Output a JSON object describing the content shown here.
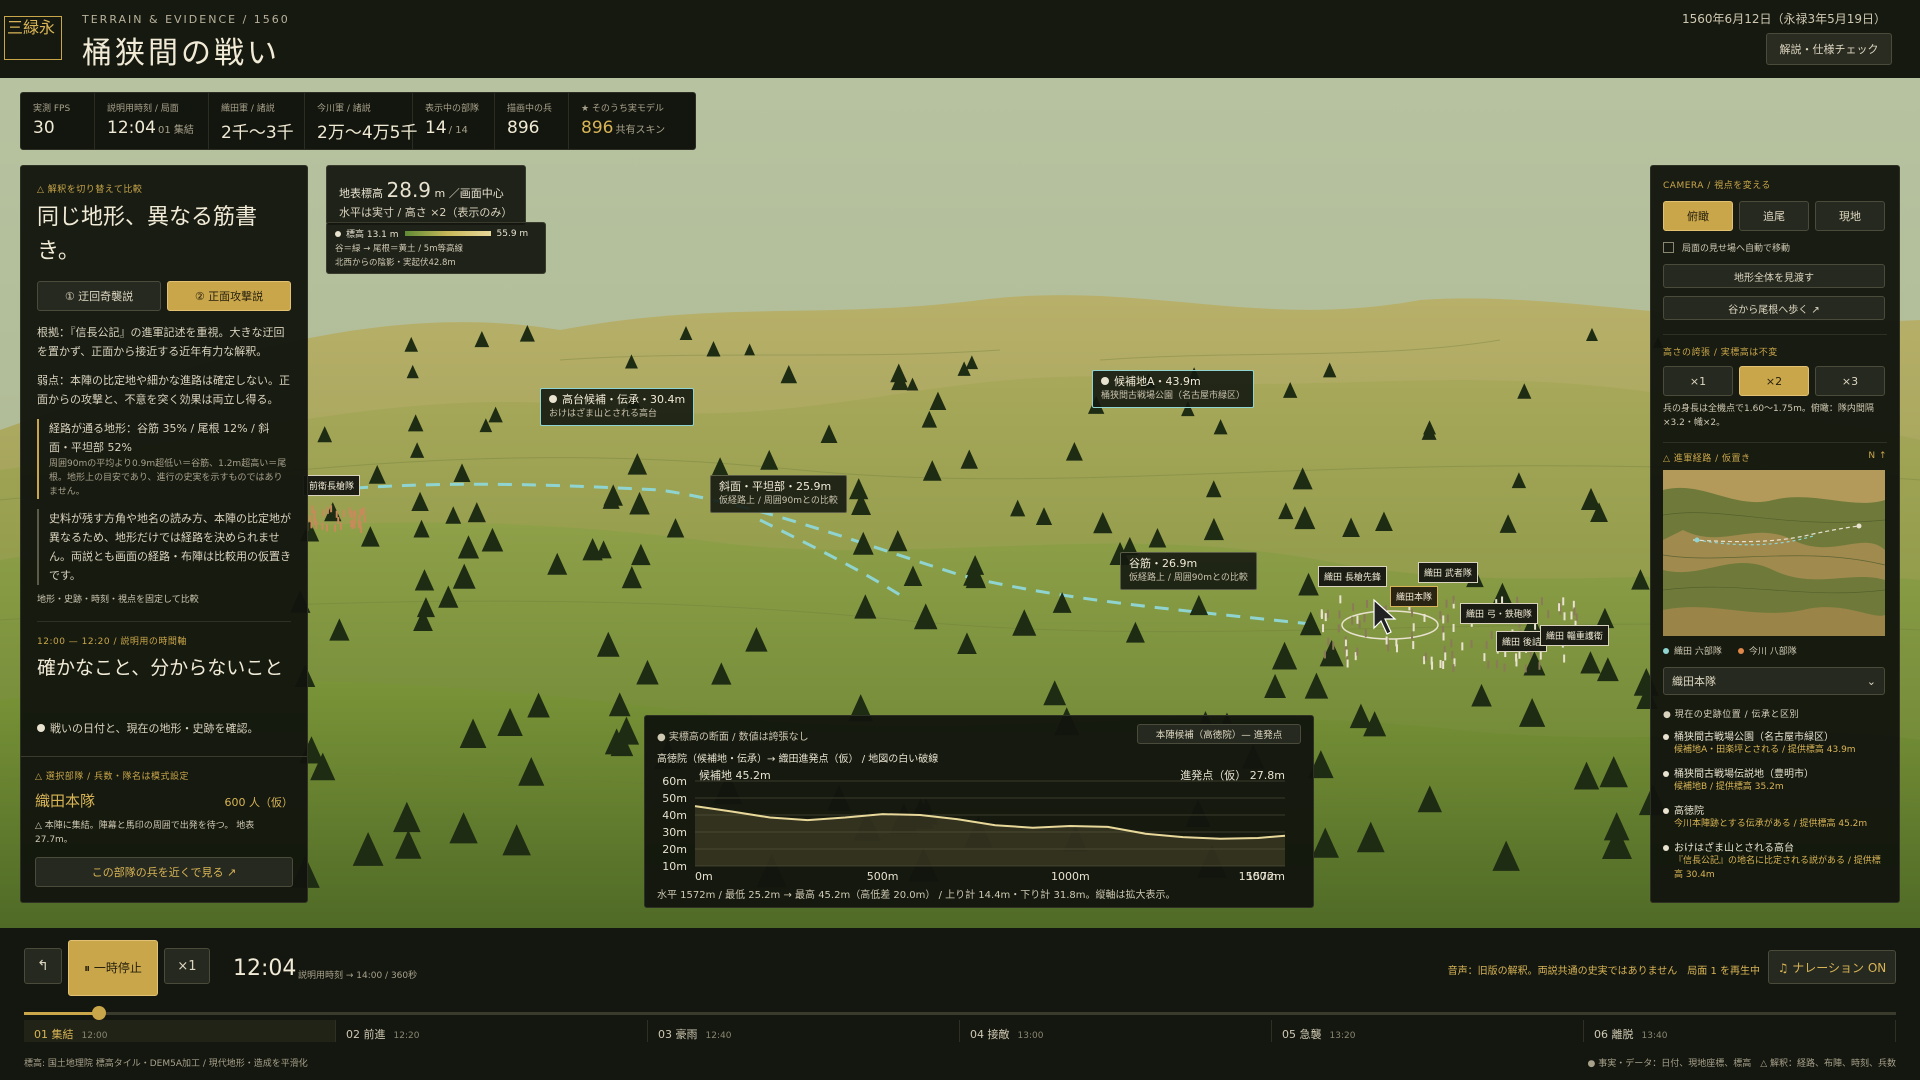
{
  "header": {
    "logo": "三緑永",
    "supertitle": "TERRAIN & EVIDENCE / 1560",
    "title": "桶狭間の戦い",
    "date": "1560年6月12日（永禄3年5月19日）",
    "spec_button": "解説・仕様チェック"
  },
  "stats": [
    {
      "label": "実測 FPS",
      "value": "30",
      "sub": ""
    },
    {
      "label": "説明用時刻 / 局面",
      "value": "12:04",
      "sub": "01 集結"
    },
    {
      "label": "織田軍 / 諸説",
      "value": "2千〜3千",
      "sub": ""
    },
    {
      "label": "今川軍 / 諸説",
      "value": "2万〜4万5千",
      "sub": ""
    },
    {
      "label": "表示中の部隊",
      "value": "14",
      "sub": "/ 14"
    },
    {
      "label": "描画中の兵",
      "value": "896",
      "sub": ""
    },
    {
      "label": "★ そのうち実モデル",
      "value": "896",
      "sub": "共有スキン"
    }
  ],
  "left": {
    "sec1": "△ 解釈を切り替えて比較",
    "heading1": "同じ地形、異なる筋書き。",
    "tab1": "① 迂回奇襲説",
    "tab2": "② 正面攻撃説",
    "p1": "根拠：『信長公記』の進軍記述を重視。大きな迂回を置かず、正面から接近する近年有力な解釈。",
    "p2": "弱点：本陣の比定地や細かな進路は確定しない。正面からの攻撃と、不意を突く効果は両立し得る。",
    "q_main": "経路が通る地形：谷筋 35% / 尾根 12% / 斜面・平坦部 52%",
    "q_small": "周囲90mの平均より0.9m超低い＝谷筋、1.2m超高い＝尾根。地形上の目安であり、進行の史実を示すものではありません。",
    "p3": "史料が残す方角や地名の読み方、本陣の比定地が異なるため、地形だけでは経路を決められません。両説とも画面の経路・布陣は比較用の仮置きです。",
    "fixed_note": "地形・史跡・時刻・視点を固定して比較",
    "sec2": "12:00 — 12:20 / 説明用の時間軸",
    "heading2": "確かなこと、分からないこと",
    "bullet": "戦いの日付と、現在の地形・史跡を確認。",
    "sec3": "△ 選択部隊 / 兵数・隊名は模式設定",
    "unit_name": "織田本隊",
    "unit_count": "600 人（仮）",
    "unit_desc": "△ 本陣に集結。陣幕と馬印の周囲で出発を待つ。 地表 27.7m。",
    "unit_button": "この部隊の兵を近くで見る ↗"
  },
  "elev": {
    "prefix": "地表標高",
    "value": "28.9",
    "unit": "m",
    "suffix": "／画面中心",
    "line2": "水平は実寸 / 高さ ×2（表示のみ）",
    "lg_min": "標高 13.1 m",
    "lg_max": "55.9 m",
    "lg_note1": "谷＝緑 → 尾根＝黄土 / 5m等高線",
    "lg_note2": "北西からの陰影・実起伏42.8m"
  },
  "labels": [
    {
      "title": "高台候補・伝承・30.4m",
      "sub": "おけはざま山とされる高台",
      "dot": true
    },
    {
      "title": "候補地A・43.9m",
      "sub": "桶狭間古戦場公園（名古屋市緑区）",
      "dot": true
    },
    {
      "title": "斜面・平坦部・25.9m",
      "sub": "仮経路上 / 周囲90mとの比較",
      "dot": false
    },
    {
      "title": "谷筋・26.9m",
      "sub": "仮経路上 / 周囲90mとの比較",
      "dot": false
    }
  ],
  "units": [
    "前衛長槍隊",
    "織田 長槍先鋒",
    "織田 武者隊",
    "織田本隊",
    "織田 弓・鉄砲隊",
    "織田 後詰",
    "織田 輜重護衛"
  ],
  "right": {
    "sec_camera": "CAMERA / 視点を変える",
    "cam": [
      "俯瞰",
      "追尾",
      "現地"
    ],
    "auto_move": "局面の見せ場へ自動で移動",
    "btn_overview": "地形全体を見渡す",
    "btn_walk": "谷から尾根へ歩く ↗",
    "sec_height": "高さの誇張 / 実標高は不変",
    "height": [
      "×1",
      "×2",
      "×3"
    ],
    "height_note": "兵の身長は全機点で1.60〜1.75m。俯瞰：隊内間隔×3.2・幟×2。",
    "sec_map": "△ 進軍経路 / 仮置き",
    "map_north": "N ↑",
    "legend_oda": "織田 六部隊",
    "legend_imagawa": "今川 八部隊",
    "select": "織田本隊",
    "sec_sites": "● 現在の史跡位置 / 伝承と区別",
    "sites": [
      {
        "name": "桶狭間古戦場公園（名古屋市緑区）",
        "sub": "候補地A・田楽坪とされる / 提供標高 43.9m"
      },
      {
        "name": "桶狭間古戦場伝説地（豊明市）",
        "sub": "候補地B / 提供標高 35.2m"
      },
      {
        "name": "高徳院",
        "sub": "今川本陣跡とする伝承がある / 提供標高 45.2m"
      },
      {
        "name": "おけはざま山とされる高台",
        "sub": "『信長公記』の地名に比定される説がある / 提供標高 30.4m"
      }
    ]
  },
  "chart_data": {
    "type": "area",
    "title": "● 実標高の断面 / 数値は誇張なし",
    "subtitle": "高徳院（候補地・伝承）→ 織田進発点（仮） / 地図の白い破線",
    "dropdown": "本陣候補（高徳院）— 進発点",
    "start_label": "候補地 45.2m",
    "end_label": "進発点（仮） 27.8m",
    "x": [
      0,
      100,
      200,
      300,
      400,
      500,
      600,
      700,
      800,
      900,
      1000,
      1100,
      1200,
      1300,
      1400,
      1500,
      1572
    ],
    "y": [
      45.2,
      42.0,
      38.5,
      37.0,
      38.5,
      40.5,
      40.0,
      37.5,
      34.0,
      32.5,
      33.5,
      33.0,
      29.0,
      27.0,
      26.0,
      26.5,
      27.8
    ],
    "yticks": [
      "60m",
      "50m",
      "40m",
      "30m",
      "20m",
      "10m"
    ],
    "yvals": [
      60,
      50,
      40,
      30,
      20,
      10
    ],
    "ylim": [
      10,
      60
    ],
    "xticks": [
      "0m",
      "500m",
      "1000m",
      "1500m",
      "1572m"
    ],
    "xvals": [
      0,
      500,
      1000,
      1500,
      1572
    ],
    "xlim": [
      0,
      1572
    ],
    "footer": "水平 1572m / 最低 25.2m → 最高 45.2m（高低差 20.0m） / 上り計 14.4m・下り計 31.8m。縦軸は拡大表示。"
  },
  "timeline": {
    "pause": "⏸ 一時停止",
    "speed": "×1",
    "time": "12:04",
    "time_note": "説明用時刻 → 14:00 / 360秒",
    "audio": "音声：旧版の解釈。両説共通の史実ではありません　局面 1 を再生中",
    "narration": "♫ ナレーション ON",
    "progress": 0.04,
    "phases": [
      {
        "label": "01 集結",
        "time": "12:00"
      },
      {
        "label": "02 前進",
        "time": "12:20"
      },
      {
        "label": "03 豪雨",
        "time": "12:40"
      },
      {
        "label": "04 接敵",
        "time": "13:00"
      },
      {
        "label": "05 急襲",
        "time": "13:20"
      },
      {
        "label": "06 離脱",
        "time": "13:40"
      }
    ],
    "source": "標高: 国土地理院 標高タイル・DEM5A加工 / 現代地形・造成を平滑化",
    "legend_note": "● 事実・データ：日付、現地座標、標高　△ 解釈：経路、布陣、時刻、兵数"
  },
  "colors": {
    "accent": "#c9a64a",
    "route": "#8fd4d0",
    "oda": "#8fd4d0",
    "imagawa": "#e0874a"
  }
}
